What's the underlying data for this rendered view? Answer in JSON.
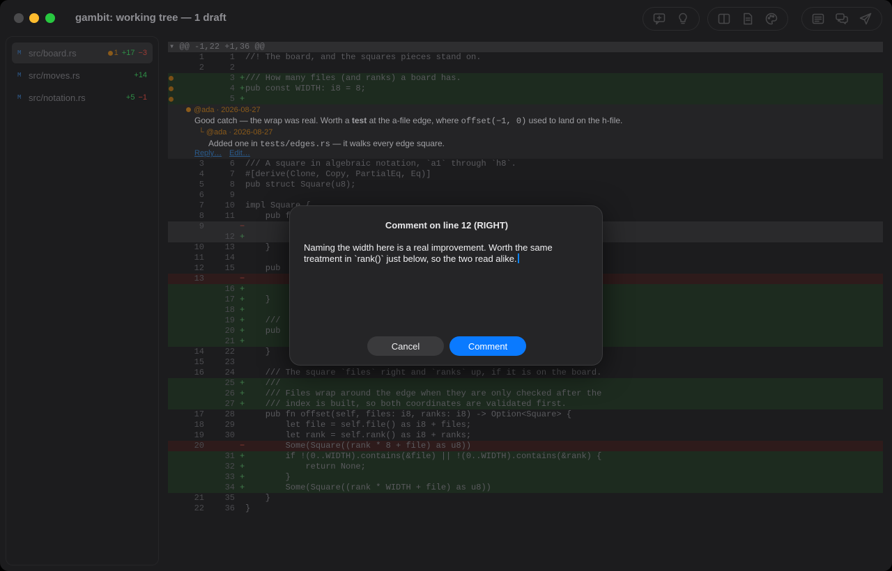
{
  "window": {
    "title": "gambit: working tree — 1 draft"
  },
  "toolbar": {
    "icons": [
      "add-comment-icon",
      "lightbulb-icon",
      "split-view-icon",
      "document-icon",
      "palette-icon",
      "list-icon",
      "comments-icon",
      "send-icon"
    ]
  },
  "sidebar": {
    "files": [
      {
        "status": "M",
        "name": "src/board.rs",
        "comments": "1",
        "added": "+17",
        "removed": "−3",
        "selected": true
      },
      {
        "status": "M",
        "name": "src/moves.rs",
        "comments": "",
        "added": "+14",
        "removed": "",
        "selected": false
      },
      {
        "status": "M",
        "name": "src/notation.rs",
        "comments": "",
        "added": "+5",
        "removed": "−1",
        "selected": false
      }
    ]
  },
  "diff": {
    "hunk_header": "▾ @@ -1,22 +1,36 @@",
    "rows_before_thread": [
      {
        "old": "1",
        "new": "1",
        "mark": "",
        "type": "ctx",
        "dot": false,
        "code": "//! The board, and the squares pieces stand on."
      },
      {
        "old": "2",
        "new": "2",
        "mark": "",
        "type": "ctx",
        "dot": false,
        "code": ""
      },
      {
        "old": "",
        "new": "3",
        "mark": "+",
        "type": "add",
        "dot": true,
        "code": "/// How many files (and ranks) a board has."
      },
      {
        "old": "",
        "new": "4",
        "mark": "+",
        "type": "add",
        "dot": true,
        "code": "pub const WIDTH: i8 = 8;"
      },
      {
        "old": "",
        "new": "5",
        "mark": "+",
        "type": "add",
        "dot": true,
        "code": ""
      }
    ],
    "thread": {
      "author": "@ada · 2026-08-27",
      "body_pre": "Good catch — the wrap was real. Worth a ",
      "body_bold": "test",
      "body_mid": " at the a-file edge, where ",
      "body_code": "offset(−1, 0)",
      "body_post": " used to land on the h-file.",
      "reply_author": "└ @ada · 2026-08-27",
      "reply_pre": "Added one in ",
      "reply_code": "tests/edges.rs",
      "reply_post": " — it walks every edge square.",
      "reply_link": "Reply…",
      "edit_link": "Edit…"
    },
    "rows_after_thread": [
      {
        "old": "3",
        "new": "6",
        "mark": "",
        "type": "ctx",
        "code": "/// A square in algebraic notation, `a1` through `h8`."
      },
      {
        "old": "4",
        "new": "7",
        "mark": "",
        "type": "ctx",
        "code": "#[derive(Clone, Copy, PartialEq, Eq)]"
      },
      {
        "old": "5",
        "new": "8",
        "mark": "",
        "type": "ctx",
        "code": "pub struct Square(u8);"
      },
      {
        "old": "6",
        "new": "9",
        "mark": "",
        "type": "ctx",
        "code": ""
      },
      {
        "old": "7",
        "new": "10",
        "mark": "",
        "type": "ctx",
        "code": "impl Square {"
      },
      {
        "old": "8",
        "new": "11",
        "mark": "",
        "type": "ctx",
        "code": "    pub fn"
      },
      {
        "old": "9",
        "new": "",
        "mark": "−",
        "type": "hl",
        "code": ""
      },
      {
        "old": "",
        "new": "12",
        "mark": "+",
        "type": "hl",
        "code": ""
      },
      {
        "old": "10",
        "new": "13",
        "mark": "",
        "type": "ctx",
        "code": "    }"
      },
      {
        "old": "11",
        "new": "14",
        "mark": "",
        "type": "ctx",
        "code": ""
      },
      {
        "old": "12",
        "new": "15",
        "mark": "",
        "type": "ctx",
        "code": "    pub"
      },
      {
        "old": "13",
        "new": "",
        "mark": "−",
        "type": "del",
        "code": ""
      },
      {
        "old": "",
        "new": "16",
        "mark": "+",
        "type": "add",
        "code": ""
      },
      {
        "old": "",
        "new": "17",
        "mark": "+",
        "type": "add",
        "code": "    }"
      },
      {
        "old": "",
        "new": "18",
        "mark": "+",
        "type": "add",
        "code": ""
      },
      {
        "old": "",
        "new": "19",
        "mark": "+",
        "type": "add",
        "code": "    ///"
      },
      {
        "old": "",
        "new": "20",
        "mark": "+",
        "type": "add",
        "code": "    pub"
      },
      {
        "old": "",
        "new": "21",
        "mark": "+",
        "type": "add",
        "code": ""
      },
      {
        "old": "14",
        "new": "22",
        "mark": "",
        "type": "ctx",
        "code": "    }"
      },
      {
        "old": "15",
        "new": "23",
        "mark": "",
        "type": "ctx",
        "code": ""
      },
      {
        "old": "16",
        "new": "24",
        "mark": "",
        "type": "ctx",
        "code": "    /// The square `files` right and `ranks` up, if it is on the board."
      },
      {
        "old": "",
        "new": "25",
        "mark": "+",
        "type": "add",
        "code": "    ///"
      },
      {
        "old": "",
        "new": "26",
        "mark": "+",
        "type": "add",
        "code": "    /// Files wrap around the edge when they are only checked after the"
      },
      {
        "old": "",
        "new": "27",
        "mark": "+",
        "type": "add",
        "code": "    /// index is built, so both coordinates are validated first."
      },
      {
        "old": "17",
        "new": "28",
        "mark": "",
        "type": "ctx",
        "code": "    pub fn offset(self, files: i8, ranks: i8) -> Option<Square> {"
      },
      {
        "old": "18",
        "new": "29",
        "mark": "",
        "type": "ctx",
        "code": "        let file = self.file() as i8 + files;"
      },
      {
        "old": "19",
        "new": "30",
        "mark": "",
        "type": "ctx",
        "code": "        let rank = self.rank() as i8 + ranks;"
      },
      {
        "old": "20",
        "new": "",
        "mark": "−",
        "type": "del",
        "code": "        Some(Square((rank * 8 + file) as u8))"
      },
      {
        "old": "",
        "new": "31",
        "mark": "+",
        "type": "add",
        "code": "        if !(0..WIDTH).contains(&file) || !(0..WIDTH).contains(&rank) {"
      },
      {
        "old": "",
        "new": "32",
        "mark": "+",
        "type": "add",
        "code": "            return None;"
      },
      {
        "old": "",
        "new": "33",
        "mark": "+",
        "type": "add",
        "code": "        }"
      },
      {
        "old": "",
        "new": "34",
        "mark": "+",
        "type": "add",
        "code": "        Some(Square((rank * WIDTH + file) as u8))"
      },
      {
        "old": "21",
        "new": "35",
        "mark": "",
        "type": "ctx",
        "code": "    }"
      },
      {
        "old": "22",
        "new": "36",
        "mark": "",
        "type": "ctx",
        "code": "}"
      }
    ]
  },
  "modal": {
    "title": "Comment on line 12 (RIGHT)",
    "text": "Naming the width here is a real improvement. Worth the same treatment in `rank()` just below, so the two read alike.",
    "cancel_label": "Cancel",
    "comment_label": "Comment"
  }
}
